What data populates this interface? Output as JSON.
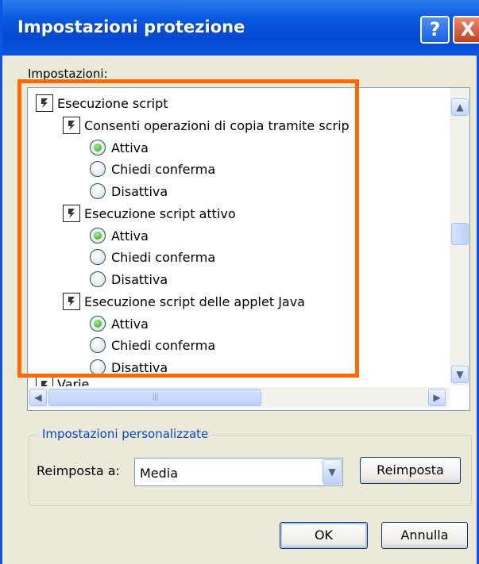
{
  "window": {
    "title": "Impostazioni protezione"
  },
  "titlebar_buttons": {
    "help": "?",
    "close": "X"
  },
  "settings_label": "Impostazioni:",
  "tree": {
    "header": "Esecuzione script",
    "groups": [
      {
        "label": "Consenti operazioni di copia tramite scrip",
        "options": [
          {
            "label": "Attiva",
            "checked": true
          },
          {
            "label": "Chiedi conferma",
            "checked": false
          },
          {
            "label": "Disattiva",
            "checked": false
          }
        ]
      },
      {
        "label": "Esecuzione script attivo",
        "options": [
          {
            "label": "Attiva",
            "checked": true
          },
          {
            "label": "Chiedi conferma",
            "checked": false
          },
          {
            "label": "Disattiva",
            "checked": false
          }
        ]
      },
      {
        "label": "Esecuzione script delle applet Java",
        "options": [
          {
            "label": "Attiva",
            "checked": true
          },
          {
            "label": "Chiedi conferma",
            "checked": false
          },
          {
            "label": "Disattiva",
            "checked": false
          }
        ]
      }
    ],
    "next_partial": "Varie"
  },
  "custom": {
    "title": "Impostazioni personalizzate",
    "reset_label": "Reimposta a:",
    "reset_value": "Media",
    "reset_button": "Reimposta"
  },
  "footer": {
    "ok": "OK",
    "cancel": "Annulla"
  },
  "colors": {
    "highlight": "#ff6a00",
    "title_bar": "#0858de",
    "dialog_bg": "#ece9d8"
  }
}
